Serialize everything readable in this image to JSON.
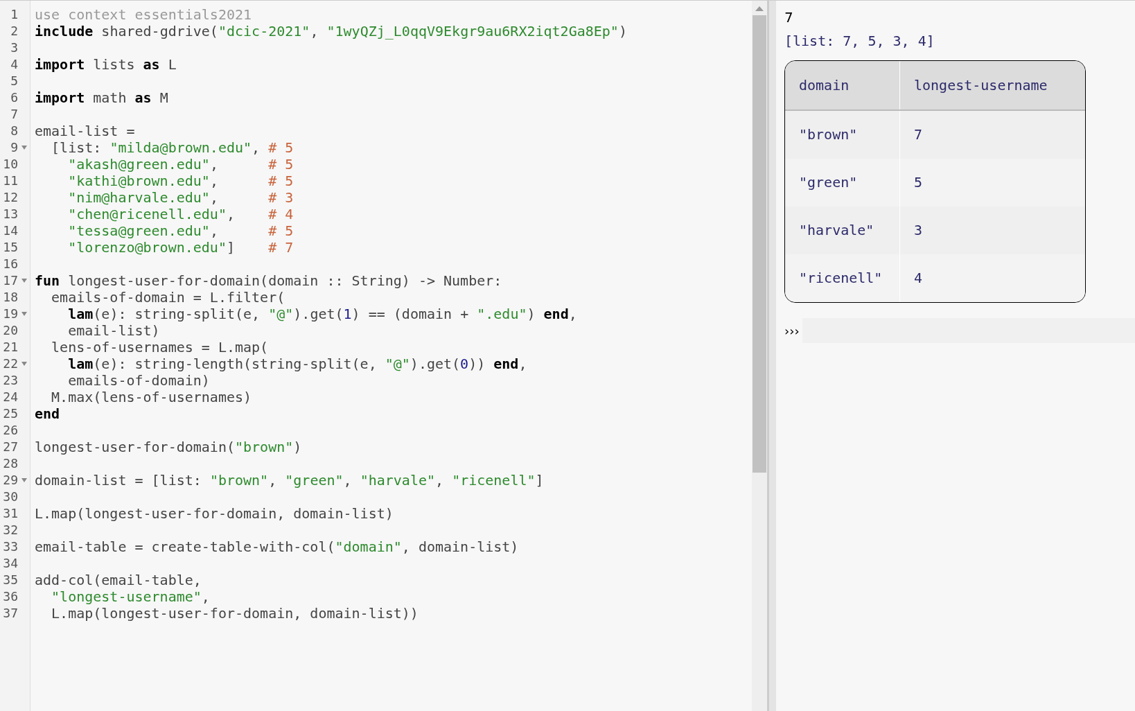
{
  "editor": {
    "lines": [
      {
        "number": "1",
        "fold_marker": false,
        "tokens": [
          {
            "kind": "context",
            "text": "use context essentials2021"
          }
        ]
      },
      {
        "number": "2",
        "fold_marker": false,
        "tokens": [
          {
            "kind": "keyword",
            "text": "include"
          },
          {
            "kind": "plain",
            "text": " shared-gdrive("
          },
          {
            "kind": "string",
            "text": "\"dcic-2021\""
          },
          {
            "kind": "plain",
            "text": ", "
          },
          {
            "kind": "string",
            "text": "\"1wyQZj_L0qqV9Ekgr9au6RX2iqt2Ga8Ep\""
          },
          {
            "kind": "plain",
            "text": ")"
          }
        ]
      },
      {
        "number": "3",
        "fold_marker": false
      },
      {
        "number": "4",
        "fold_marker": false,
        "tokens": [
          {
            "kind": "keyword",
            "text": "import"
          },
          {
            "kind": "plain",
            "text": " lists "
          },
          {
            "kind": "keyword",
            "text": "as"
          },
          {
            "kind": "plain",
            "text": " L"
          }
        ]
      },
      {
        "number": "5",
        "fold_marker": false
      },
      {
        "number": "6",
        "fold_marker": false,
        "tokens": [
          {
            "kind": "keyword",
            "text": "import"
          },
          {
            "kind": "plain",
            "text": " math "
          },
          {
            "kind": "keyword",
            "text": "as"
          },
          {
            "kind": "plain",
            "text": " M"
          }
        ]
      },
      {
        "number": "7",
        "fold_marker": false
      },
      {
        "number": "8",
        "fold_marker": false,
        "tokens": [
          {
            "kind": "plain",
            "text": "email-list ="
          }
        ]
      },
      {
        "number": "9",
        "fold_marker": true,
        "tokens": [
          {
            "kind": "plain",
            "text": "  [list: "
          },
          {
            "kind": "string",
            "text": "\"milda@brown.edu\""
          },
          {
            "kind": "plain",
            "text": ", "
          },
          {
            "kind": "comment",
            "text": "# 5"
          }
        ]
      },
      {
        "number": "10",
        "fold_marker": false,
        "tokens": [
          {
            "kind": "string",
            "text": "    \"akash@green.edu\""
          },
          {
            "kind": "plain",
            "text": ",      "
          },
          {
            "kind": "comment",
            "text": "# 5"
          }
        ]
      },
      {
        "number": "11",
        "fold_marker": false,
        "tokens": [
          {
            "kind": "string",
            "text": "    \"kathi@brown.edu\""
          },
          {
            "kind": "plain",
            "text": ",      "
          },
          {
            "kind": "comment",
            "text": "# 5"
          }
        ]
      },
      {
        "number": "12",
        "fold_marker": false,
        "tokens": [
          {
            "kind": "string",
            "text": "    \"nim@harvale.edu\""
          },
          {
            "kind": "plain",
            "text": ",      "
          },
          {
            "kind": "comment",
            "text": "# 3"
          }
        ]
      },
      {
        "number": "13",
        "fold_marker": false,
        "tokens": [
          {
            "kind": "string",
            "text": "    \"chen@ricenell.edu\""
          },
          {
            "kind": "plain",
            "text": ",    "
          },
          {
            "kind": "comment",
            "text": "# 4"
          }
        ]
      },
      {
        "number": "14",
        "fold_marker": false,
        "tokens": [
          {
            "kind": "string",
            "text": "    \"tessa@green.edu\""
          },
          {
            "kind": "plain",
            "text": ",      "
          },
          {
            "kind": "comment",
            "text": "# 5"
          }
        ]
      },
      {
        "number": "15",
        "fold_marker": false,
        "tokens": [
          {
            "kind": "string",
            "text": "    \"lorenzo@brown.edu\""
          },
          {
            "kind": "plain",
            "text": "]    "
          },
          {
            "kind": "comment",
            "text": "# 7"
          }
        ]
      },
      {
        "number": "16",
        "fold_marker": false
      },
      {
        "number": "17",
        "fold_marker": true,
        "tokens": [
          {
            "kind": "keyword",
            "text": "fun"
          },
          {
            "kind": "plain",
            "text": " longest-user-for-domain(domain :: String) -> Number:"
          }
        ]
      },
      {
        "number": "18",
        "fold_marker": false,
        "tokens": [
          {
            "kind": "plain",
            "text": "  emails-of-domain = L.filter("
          }
        ]
      },
      {
        "number": "19",
        "fold_marker": true,
        "tokens": [
          {
            "kind": "keyword",
            "text": "    lam"
          },
          {
            "kind": "plain",
            "text": "(e): string-split(e, "
          },
          {
            "kind": "string",
            "text": "\"@\""
          },
          {
            "kind": "plain",
            "text": ").get("
          },
          {
            "kind": "number",
            "text": "1"
          },
          {
            "kind": "plain",
            "text": ") == (domain + "
          },
          {
            "kind": "string",
            "text": "\".edu\""
          },
          {
            "kind": "plain",
            "text": ") "
          },
          {
            "kind": "keyword",
            "text": "end"
          },
          {
            "kind": "plain",
            "text": ","
          }
        ]
      },
      {
        "number": "20",
        "fold_marker": false,
        "tokens": [
          {
            "kind": "plain",
            "text": "    email-list)"
          }
        ]
      },
      {
        "number": "21",
        "fold_marker": false,
        "tokens": [
          {
            "kind": "plain",
            "text": "  lens-of-usernames = L.map("
          }
        ]
      },
      {
        "number": "22",
        "fold_marker": true,
        "tokens": [
          {
            "kind": "keyword",
            "text": "    lam"
          },
          {
            "kind": "plain",
            "text": "(e): string-length(string-split(e, "
          },
          {
            "kind": "string",
            "text": "\"@\""
          },
          {
            "kind": "plain",
            "text": ").get("
          },
          {
            "kind": "number",
            "text": "0"
          },
          {
            "kind": "plain",
            "text": ")) "
          },
          {
            "kind": "keyword",
            "text": "end"
          },
          {
            "kind": "plain",
            "text": ","
          }
        ]
      },
      {
        "number": "23",
        "fold_marker": false,
        "tokens": [
          {
            "kind": "plain",
            "text": "    emails-of-domain)"
          }
        ]
      },
      {
        "number": "24",
        "fold_marker": false,
        "tokens": [
          {
            "kind": "plain",
            "text": "  M.max(lens-of-usernames)"
          }
        ]
      },
      {
        "number": "25",
        "fold_marker": false,
        "tokens": [
          {
            "kind": "keyword",
            "text": "end"
          }
        ]
      },
      {
        "number": "26",
        "fold_marker": false
      },
      {
        "number": "27",
        "fold_marker": false,
        "tokens": [
          {
            "kind": "plain",
            "text": "longest-user-for-domain("
          },
          {
            "kind": "string",
            "text": "\"brown\""
          },
          {
            "kind": "plain",
            "text": ")"
          }
        ]
      },
      {
        "number": "28",
        "fold_marker": false
      },
      {
        "number": "29",
        "fold_marker": true,
        "tokens": [
          {
            "kind": "plain",
            "text": "domain-list = [list: "
          },
          {
            "kind": "string",
            "text": "\"brown\""
          },
          {
            "kind": "plain",
            "text": ", "
          },
          {
            "kind": "string",
            "text": "\"green\""
          },
          {
            "kind": "plain",
            "text": ", "
          },
          {
            "kind": "string",
            "text": "\"harvale\""
          },
          {
            "kind": "plain",
            "text": ", "
          },
          {
            "kind": "string",
            "text": "\"ricenell\""
          },
          {
            "kind": "plain",
            "text": "]"
          }
        ]
      },
      {
        "number": "30",
        "fold_marker": false
      },
      {
        "number": "31",
        "fold_marker": false,
        "tokens": [
          {
            "kind": "plain",
            "text": "L.map(longest-user-for-domain, domain-list)"
          }
        ]
      },
      {
        "number": "32",
        "fold_marker": false
      },
      {
        "number": "33",
        "fold_marker": false,
        "tokens": [
          {
            "kind": "plain",
            "text": "email-table = create-table-with-col("
          },
          {
            "kind": "string",
            "text": "\"domain\""
          },
          {
            "kind": "plain",
            "text": ", domain-list)"
          }
        ]
      },
      {
        "number": "34",
        "fold_marker": false
      },
      {
        "number": "35",
        "fold_marker": false,
        "tokens": [
          {
            "kind": "plain",
            "text": "add-col(email-table,"
          }
        ]
      },
      {
        "number": "36",
        "fold_marker": false,
        "tokens": [
          {
            "kind": "string",
            "text": "  \"longest-username\""
          },
          {
            "kind": "plain",
            "text": ","
          }
        ]
      },
      {
        "number": "37",
        "fold_marker": false,
        "tokens": [
          {
            "kind": "plain",
            "text": "  L.map(longest-user-for-domain, domain-list))"
          }
        ]
      }
    ]
  },
  "interactions": {
    "outputs": [
      {
        "kind": "number",
        "text": "7"
      },
      {
        "kind": "list",
        "text": "[list: 7, 5, 3, 4]"
      }
    ],
    "table": {
      "columns": [
        "domain",
        "longest-username"
      ],
      "rows": [
        [
          "\"brown\"",
          "7"
        ],
        [
          "\"green\"",
          "5"
        ],
        [
          "\"harvale\"",
          "3"
        ],
        [
          "\"ricenell\"",
          "4"
        ]
      ]
    },
    "prompt": "›››"
  }
}
